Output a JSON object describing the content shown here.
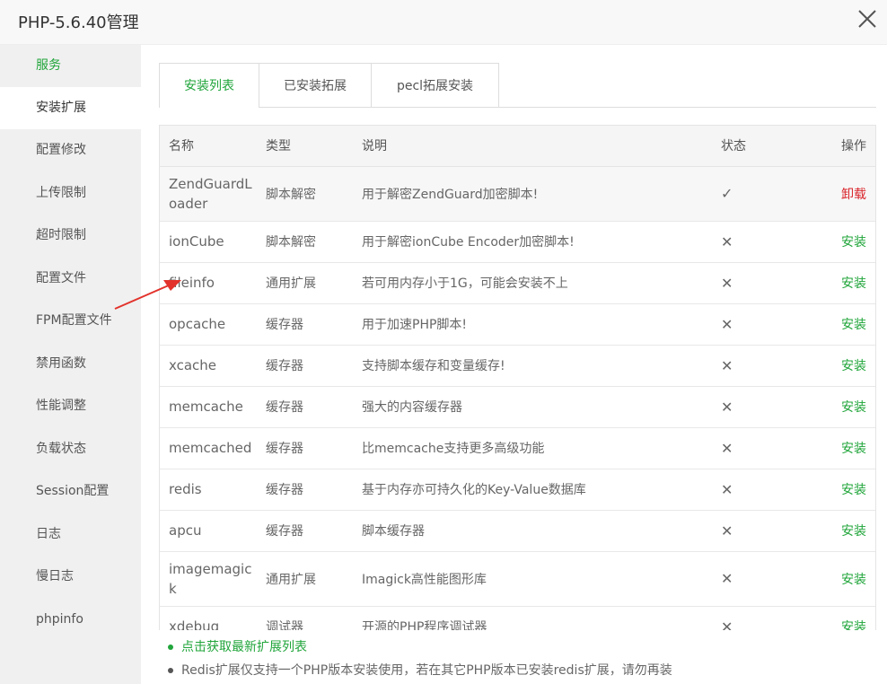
{
  "window": {
    "title": "PHP-5.6.40管理"
  },
  "sidebar": {
    "items": [
      {
        "label": "服务"
      },
      {
        "label": "安装扩展"
      },
      {
        "label": "配置修改"
      },
      {
        "label": "上传限制"
      },
      {
        "label": "超时限制"
      },
      {
        "label": "配置文件"
      },
      {
        "label": "FPM配置文件"
      },
      {
        "label": "禁用函数"
      },
      {
        "label": "性能调整"
      },
      {
        "label": "负载状态"
      },
      {
        "label": "Session配置"
      },
      {
        "label": "日志"
      },
      {
        "label": "慢日志"
      },
      {
        "label": "phpinfo"
      }
    ]
  },
  "tabs": [
    {
      "label": "安装列表"
    },
    {
      "label": "已安装拓展"
    },
    {
      "label": "pecl拓展安装"
    }
  ],
  "table": {
    "headers": {
      "name": "名称",
      "type": "类型",
      "desc": "说明",
      "status": "状态",
      "op": "操作"
    },
    "rows": [
      {
        "name": "ZendGuardLoader",
        "type": "脚本解密",
        "desc": "用于解密ZendGuard加密脚本!",
        "status": "✓",
        "op": "卸载"
      },
      {
        "name": "ionCube",
        "type": "脚本解密",
        "desc": "用于解密ionCube Encoder加密脚本!",
        "status": "✕",
        "op": "安装"
      },
      {
        "name": "fileinfo",
        "type": "通用扩展",
        "desc": "若可用内存小于1G，可能会安装不上",
        "status": "✕",
        "op": "安装"
      },
      {
        "name": "opcache",
        "type": "缓存器",
        "desc": "用于加速PHP脚本!",
        "status": "✕",
        "op": "安装"
      },
      {
        "name": "xcache",
        "type": "缓存器",
        "desc": "支持脚本缓存和变量缓存!",
        "status": "✕",
        "op": "安装"
      },
      {
        "name": "memcache",
        "type": "缓存器",
        "desc": "强大的内容缓存器",
        "status": "✕",
        "op": "安装"
      },
      {
        "name": "memcached",
        "type": "缓存器",
        "desc": "比memcache支持更多高级功能",
        "status": "✕",
        "op": "安装"
      },
      {
        "name": "redis",
        "type": "缓存器",
        "desc": "基于内存亦可持久化的Key-Value数据库",
        "status": "✕",
        "op": "安装"
      },
      {
        "name": "apcu",
        "type": "缓存器",
        "desc": "脚本缓存器",
        "status": "✕",
        "op": "安装"
      },
      {
        "name": "imagemagick",
        "type": "通用扩展",
        "desc": "Imagick高性能图形库",
        "status": "✕",
        "op": "安装"
      },
      {
        "name": "xdebug",
        "type": "调试器",
        "desc": "开源的PHP程序调试器",
        "status": "✕",
        "op": "安装"
      }
    ]
  },
  "notes": {
    "link": "点击获取最新扩展列表",
    "text": "Redis扩展仅支持一个PHP版本安装使用，若在其它PHP版本已安装redis扩展，请勿再装"
  },
  "colors": {
    "accent": "#20a53a",
    "danger": "#d9242b",
    "annotation_arrow": "#e2322b"
  },
  "icons": {
    "close": "close-icon",
    "check": "check-icon",
    "cross": "cross-icon",
    "arrow": "annotation-arrow"
  }
}
